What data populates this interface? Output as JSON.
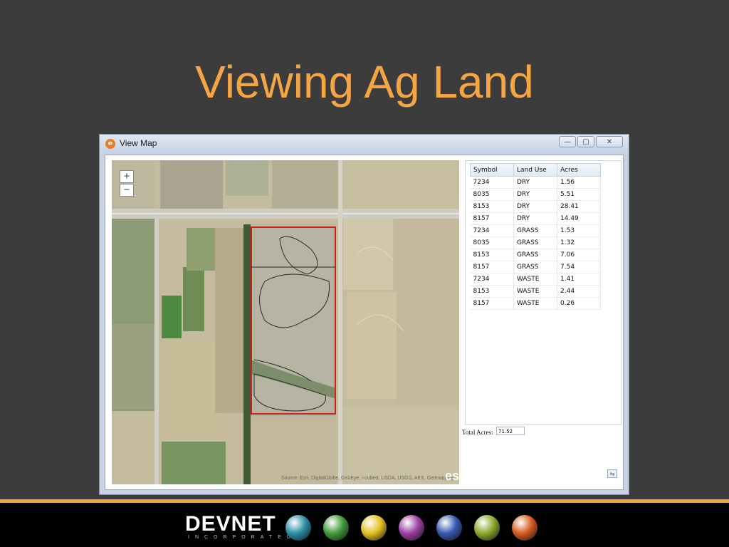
{
  "slide": {
    "title": "Viewing Ag Land"
  },
  "window": {
    "title": "View Map",
    "controls": {
      "minimize": "—",
      "maximize": "▢",
      "close": "✕"
    }
  },
  "map": {
    "zoom_in": "+",
    "zoom_out": "−",
    "attribution": "Source: Esri, DigitalGlobe, GeoEye, i-cubed, USDA, USGS, AEX, Getmapping",
    "logo": "esri"
  },
  "table": {
    "headers": [
      "Symbol",
      "Land Use",
      "Acres"
    ],
    "rows": [
      [
        "7234",
        "DRY",
        "1.56"
      ],
      [
        "8035",
        "DRY",
        "5.51"
      ],
      [
        "8153",
        "DRY",
        "28.41"
      ],
      [
        "8157",
        "DRY",
        "14.49"
      ],
      [
        "7234",
        "GRASS",
        "1.53"
      ],
      [
        "8035",
        "GRASS",
        "1.32"
      ],
      [
        "8153",
        "GRASS",
        "7.06"
      ],
      [
        "8157",
        "GRASS",
        "7.54"
      ],
      [
        "7234",
        "WASTE",
        "1.41"
      ],
      [
        "8153",
        "WASTE",
        "2.44"
      ],
      [
        "8157",
        "WASTE",
        "0.26"
      ]
    ]
  },
  "totals": {
    "label": "Total Acres:",
    "value": "71.52"
  },
  "footer": {
    "logo_main": "DEVNET",
    "logo_sub": "INCORPORATED",
    "icons": [
      {
        "name": "teal-ball-icon",
        "color": "#2a8fa6"
      },
      {
        "name": "green-ball-icon",
        "color": "#3f9a3a"
      },
      {
        "name": "yellow-ball-icon",
        "color": "#e2c021"
      },
      {
        "name": "purple-ball-icon",
        "color": "#9b3fa3"
      },
      {
        "name": "blue-ball-icon",
        "color": "#3758b0"
      },
      {
        "name": "lime-ball-icon",
        "color": "#8aa82a"
      },
      {
        "name": "orange-ball-icon",
        "color": "#d65a22"
      }
    ]
  },
  "colors": {
    "title": "#f6a545",
    "background": "#3c3c3c",
    "accent_line": "#f4a83c",
    "parcel_outline": "#d0201a"
  }
}
